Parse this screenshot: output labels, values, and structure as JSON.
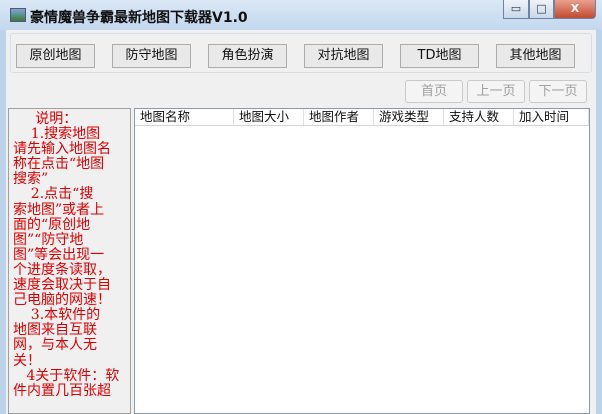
{
  "window": {
    "title": "豪情魔兽争霸最新地图下载器V1.0",
    "minimize": "▭",
    "maximize": "□",
    "close": "X"
  },
  "categories": [
    "原创地图",
    "防守地图",
    "角色扮演",
    "对抗地图",
    "TD地图",
    "其他地图"
  ],
  "pager": {
    "first": "首页",
    "prev": "上一页",
    "next": "下一页"
  },
  "notes": [
    "     说明：",
    "    1.搜索地图",
    "请先输入地图名",
    "称在点击“地图",
    "搜索”",
    "    2.点击“搜",
    "索地图”或者上",
    "面的“原创地",
    "图”“防守地",
    "图”等会出现一",
    "个进度条读取，",
    "速度会取决于自",
    "己电脑的网速！",
    "    3.本软件的",
    "地图来自互联",
    "网，与本人无",
    "关！",
    "   4关于软件：软",
    "件内置几百张超"
  ],
  "list": {
    "columns": [
      "地图名称",
      "地图大小",
      "地图作者",
      "游戏类型",
      "支持人数",
      "加入时间"
    ],
    "rows": []
  }
}
